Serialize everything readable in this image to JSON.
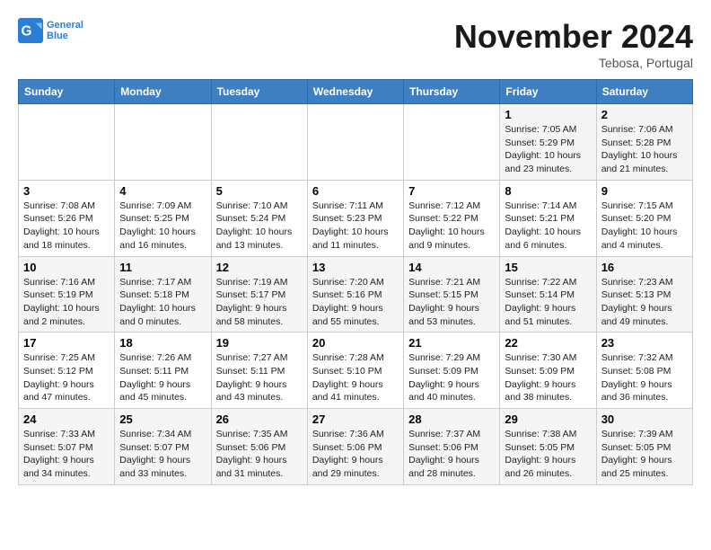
{
  "logo": {
    "text_general": "General",
    "text_blue": "Blue"
  },
  "header": {
    "month": "November 2024",
    "location": "Tebosa, Portugal"
  },
  "weekdays": [
    "Sunday",
    "Monday",
    "Tuesday",
    "Wednesday",
    "Thursday",
    "Friday",
    "Saturday"
  ],
  "weeks": [
    [
      {
        "day": "",
        "info": ""
      },
      {
        "day": "",
        "info": ""
      },
      {
        "day": "",
        "info": ""
      },
      {
        "day": "",
        "info": ""
      },
      {
        "day": "",
        "info": ""
      },
      {
        "day": "1",
        "info": "Sunrise: 7:05 AM\nSunset: 5:29 PM\nDaylight: 10 hours and 23 minutes."
      },
      {
        "day": "2",
        "info": "Sunrise: 7:06 AM\nSunset: 5:28 PM\nDaylight: 10 hours and 21 minutes."
      }
    ],
    [
      {
        "day": "3",
        "info": "Sunrise: 7:08 AM\nSunset: 5:26 PM\nDaylight: 10 hours and 18 minutes."
      },
      {
        "day": "4",
        "info": "Sunrise: 7:09 AM\nSunset: 5:25 PM\nDaylight: 10 hours and 16 minutes."
      },
      {
        "day": "5",
        "info": "Sunrise: 7:10 AM\nSunset: 5:24 PM\nDaylight: 10 hours and 13 minutes."
      },
      {
        "day": "6",
        "info": "Sunrise: 7:11 AM\nSunset: 5:23 PM\nDaylight: 10 hours and 11 minutes."
      },
      {
        "day": "7",
        "info": "Sunrise: 7:12 AM\nSunset: 5:22 PM\nDaylight: 10 hours and 9 minutes."
      },
      {
        "day": "8",
        "info": "Sunrise: 7:14 AM\nSunset: 5:21 PM\nDaylight: 10 hours and 6 minutes."
      },
      {
        "day": "9",
        "info": "Sunrise: 7:15 AM\nSunset: 5:20 PM\nDaylight: 10 hours and 4 minutes."
      }
    ],
    [
      {
        "day": "10",
        "info": "Sunrise: 7:16 AM\nSunset: 5:19 PM\nDaylight: 10 hours and 2 minutes."
      },
      {
        "day": "11",
        "info": "Sunrise: 7:17 AM\nSunset: 5:18 PM\nDaylight: 10 hours and 0 minutes."
      },
      {
        "day": "12",
        "info": "Sunrise: 7:19 AM\nSunset: 5:17 PM\nDaylight: 9 hours and 58 minutes."
      },
      {
        "day": "13",
        "info": "Sunrise: 7:20 AM\nSunset: 5:16 PM\nDaylight: 9 hours and 55 minutes."
      },
      {
        "day": "14",
        "info": "Sunrise: 7:21 AM\nSunset: 5:15 PM\nDaylight: 9 hours and 53 minutes."
      },
      {
        "day": "15",
        "info": "Sunrise: 7:22 AM\nSunset: 5:14 PM\nDaylight: 9 hours and 51 minutes."
      },
      {
        "day": "16",
        "info": "Sunrise: 7:23 AM\nSunset: 5:13 PM\nDaylight: 9 hours and 49 minutes."
      }
    ],
    [
      {
        "day": "17",
        "info": "Sunrise: 7:25 AM\nSunset: 5:12 PM\nDaylight: 9 hours and 47 minutes."
      },
      {
        "day": "18",
        "info": "Sunrise: 7:26 AM\nSunset: 5:11 PM\nDaylight: 9 hours and 45 minutes."
      },
      {
        "day": "19",
        "info": "Sunrise: 7:27 AM\nSunset: 5:11 PM\nDaylight: 9 hours and 43 minutes."
      },
      {
        "day": "20",
        "info": "Sunrise: 7:28 AM\nSunset: 5:10 PM\nDaylight: 9 hours and 41 minutes."
      },
      {
        "day": "21",
        "info": "Sunrise: 7:29 AM\nSunset: 5:09 PM\nDaylight: 9 hours and 40 minutes."
      },
      {
        "day": "22",
        "info": "Sunrise: 7:30 AM\nSunset: 5:09 PM\nDaylight: 9 hours and 38 minutes."
      },
      {
        "day": "23",
        "info": "Sunrise: 7:32 AM\nSunset: 5:08 PM\nDaylight: 9 hours and 36 minutes."
      }
    ],
    [
      {
        "day": "24",
        "info": "Sunrise: 7:33 AM\nSunset: 5:07 PM\nDaylight: 9 hours and 34 minutes."
      },
      {
        "day": "25",
        "info": "Sunrise: 7:34 AM\nSunset: 5:07 PM\nDaylight: 9 hours and 33 minutes."
      },
      {
        "day": "26",
        "info": "Sunrise: 7:35 AM\nSunset: 5:06 PM\nDaylight: 9 hours and 31 minutes."
      },
      {
        "day": "27",
        "info": "Sunrise: 7:36 AM\nSunset: 5:06 PM\nDaylight: 9 hours and 29 minutes."
      },
      {
        "day": "28",
        "info": "Sunrise: 7:37 AM\nSunset: 5:06 PM\nDaylight: 9 hours and 28 minutes."
      },
      {
        "day": "29",
        "info": "Sunrise: 7:38 AM\nSunset: 5:05 PM\nDaylight: 9 hours and 26 minutes."
      },
      {
        "day": "30",
        "info": "Sunrise: 7:39 AM\nSunset: 5:05 PM\nDaylight: 9 hours and 25 minutes."
      }
    ]
  ]
}
